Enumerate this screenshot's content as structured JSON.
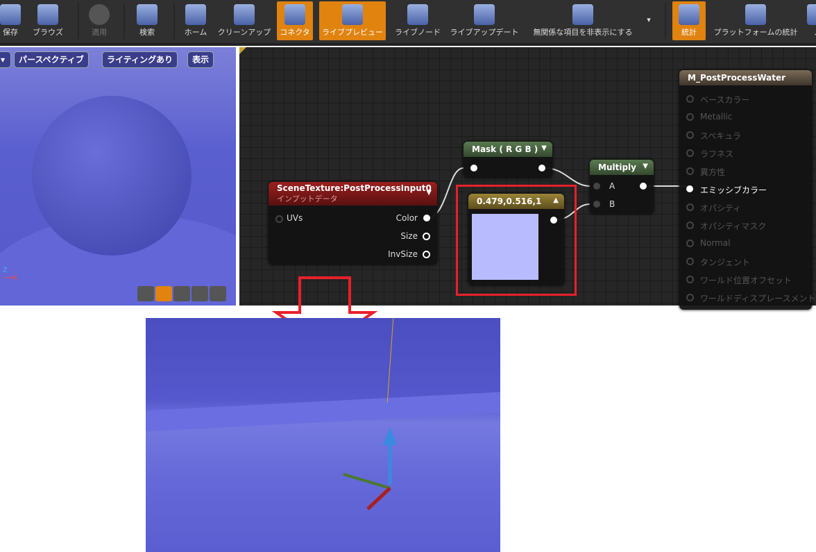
{
  "toolbar": {
    "items": [
      {
        "label": "保存",
        "icon": "save-icon"
      },
      {
        "label": "ブラウズ",
        "icon": "browse-icon"
      },
      {
        "label": "適用",
        "icon": "apply-icon",
        "disabled": true
      },
      {
        "label": "検索",
        "icon": "search-icon"
      },
      {
        "label": "ホーム",
        "icon": "home-icon"
      },
      {
        "label": "クリーンアップ",
        "icon": "cleanup-icon"
      },
      {
        "label": "コネクタ",
        "icon": "connector-icon",
        "active": true
      },
      {
        "label": "ライブプレビュー",
        "icon": "live-preview-icon",
        "active": true
      },
      {
        "label": "ライブノード",
        "icon": "live-node-icon"
      },
      {
        "label": "ライブアップデート",
        "icon": "live-update-icon"
      },
      {
        "label": "無関係な項目を非表示にする",
        "icon": "hide-unrelated-icon"
      },
      {
        "label": "統計",
        "icon": "stats-icon",
        "active": true
      },
      {
        "label": "プラットフォームの統計",
        "icon": "platform-stats-icon"
      },
      {
        "label": "ノ"
      }
    ]
  },
  "viewport": {
    "perspective": "パースペクティブ",
    "lighting": "ライティングあり",
    "show": "表示"
  },
  "graph": {
    "scene_texture": {
      "title": "SceneTexture:PostProcessInput0",
      "subtitle": "インプットデータ",
      "uvs": "UVs",
      "outputs": [
        "Color",
        "Size",
        "InvSize"
      ]
    },
    "mask": {
      "title": "Mask ( R G B )"
    },
    "constant": {
      "title": "0.479,0.516,1",
      "color": "#b8bcff"
    },
    "multiply": {
      "title": "Multiply",
      "a": "A",
      "b": "B"
    },
    "result": {
      "title": "M_PostProcessWater",
      "inputs": [
        "ベースカラー",
        "Metallic",
        "スペキュラ",
        "ラフネス",
        "異方性",
        "エミッシブカラー",
        "オパシティ",
        "オパシティマスク",
        "Normal",
        "タンジェント",
        "ワールド位置オフセット",
        "ワールドディスプレースメント"
      ],
      "active_index": 5
    }
  },
  "highlight_color": "#e8202a"
}
